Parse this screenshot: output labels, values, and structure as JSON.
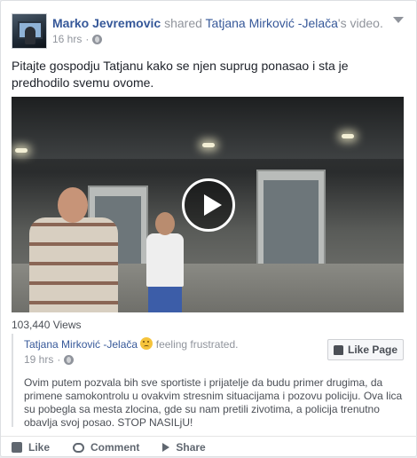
{
  "post": {
    "author": "Marko Jevremovic",
    "shared_verb": "shared",
    "shared_name": "Tatjana Mirković -Jelača",
    "shared_suffix": "'s video.",
    "time": "16 hrs",
    "separator": "·",
    "text": "Pitajte gospodju Tatjanu kako se njen suprug ponasao i sta je predhodilo svemu ovome."
  },
  "video": {
    "views": "103,440 Views"
  },
  "original": {
    "author": "Tatjana Mirković -Jelača",
    "feeling": "feeling frustrated.",
    "time": "19 hrs",
    "separator": "·",
    "like_page_label": "Like Page",
    "text": "Ovim putem pozvala bih sve sportiste i prijatelje da budu primer drugima, da primene samokontrolu u ovakvim stresnim situacijama i pozovu policiju. Ova lica su pobegla sa mesta zlocina, gde su nam pretili zivotima, a policija trenutno obavlja svoj posao. STOP NASILjU!"
  },
  "actions": {
    "like": "Like",
    "comment": "Comment",
    "share": "Share"
  },
  "colors": {
    "link": "#365899",
    "muted": "#90949c",
    "text": "#1d2129"
  },
  "icons": [
    "avatar",
    "globe-icon",
    "chevron-down-icon",
    "play-icon",
    "frustrated-emoji-icon",
    "thumbs-up-icon",
    "comment-icon",
    "share-icon"
  ]
}
